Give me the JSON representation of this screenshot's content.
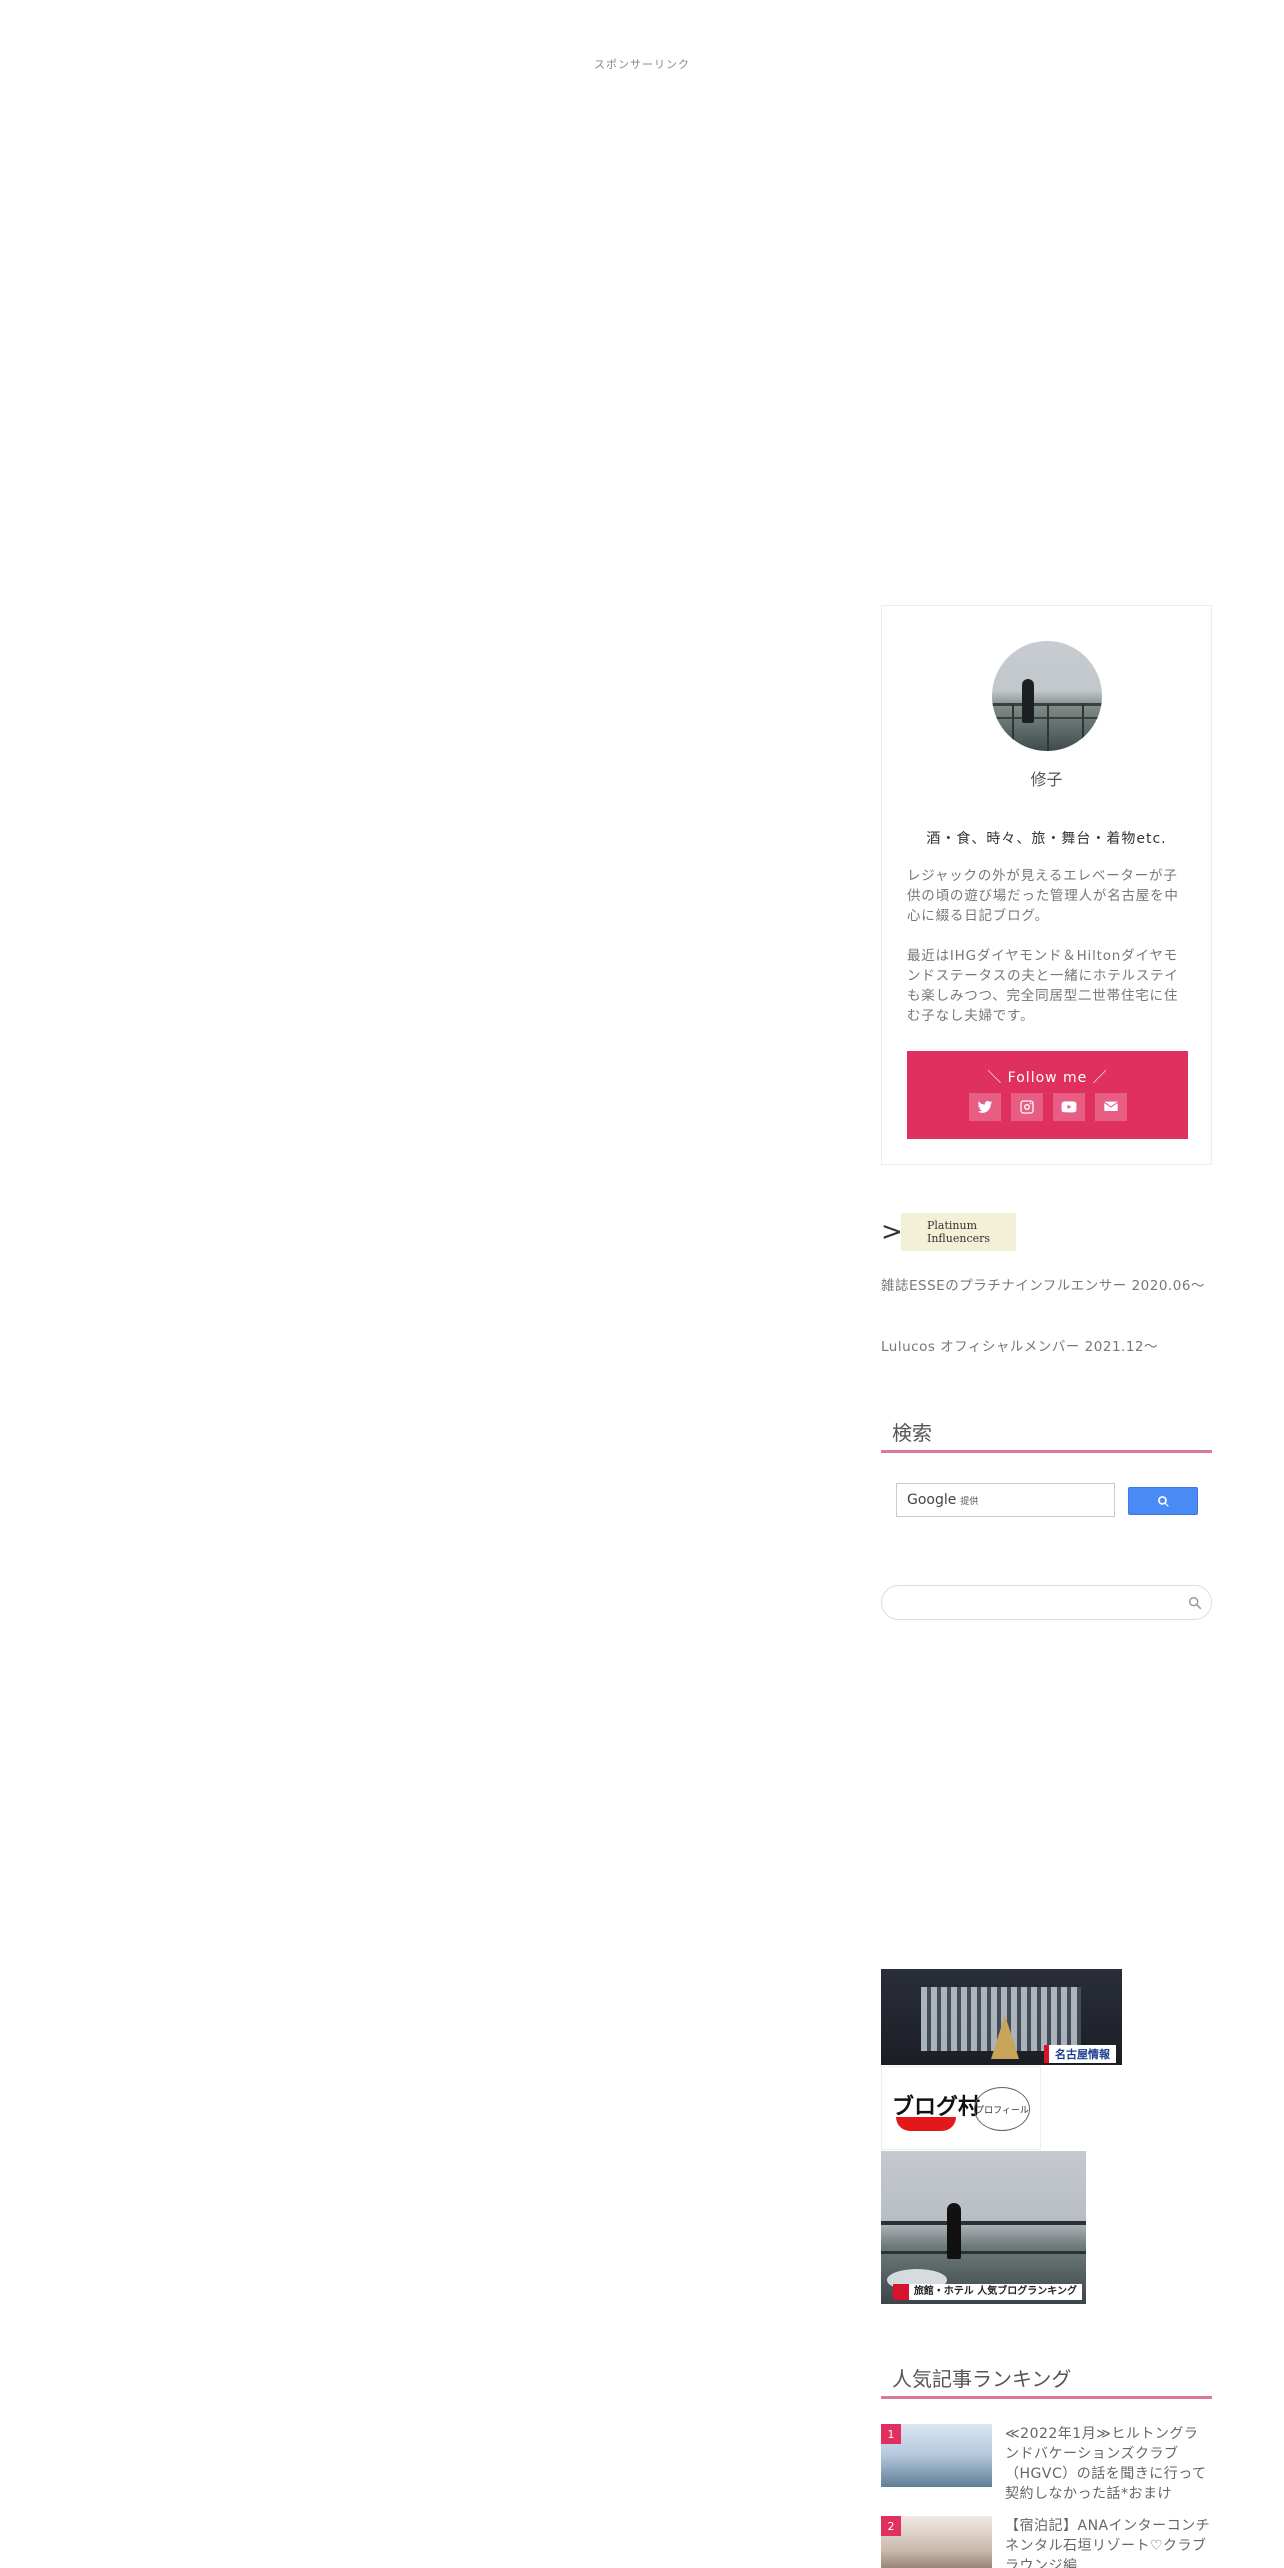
{
  "sponsor_label": "スポンサーリンク",
  "profile": {
    "name": "修子",
    "tagline": "酒・食、時々、旅・舞台・着物etc.",
    "desc1": "レジャックの外が見えるエレベーターが子供の頃の遊び場だった管理人が名古屋を中心に綴る日記ブログ。",
    "desc2": "最近はIHGダイヤモンド＆Hiltonダイヤモンドステータスの夫と一緒にホテルステイも楽しみつつ、完全同居型二世帯住宅に住む子なし夫婦です。",
    "follow_title": "＼ Follow me ／",
    "social_icons": [
      "twitter-icon",
      "instagram-icon",
      "youtube-icon",
      "mail-icon"
    ]
  },
  "platinum": {
    "badge_line1": "Platinum",
    "badge_line2": "Influencers",
    "link1": "雑誌ESSEのプラチナインフルエンサー 2020.06～",
    "link2": "Lulucos オフィシャルメンバー 2021.12～"
  },
  "search_widget": {
    "title": "検索",
    "google_label": "Google",
    "google_sub": "提供"
  },
  "banners": {
    "nagoya_label": "名古屋情報",
    "blogmura_logo": "ブログ村",
    "blogmura_profile": "プロフィール",
    "hotel_label": "旅館・ホテル 人気ブログランキング"
  },
  "ranking": {
    "title": "人気記事ランキング",
    "items": [
      {
        "rank": "1",
        "title": "≪2022年1月≫ヒルトングランドバケーションズクラブ（HGVC）の話を聞きに行って契約しなかった話*おまけ"
      },
      {
        "rank": "2",
        "title": "【宿泊記】ANAインターコンチネンタル石垣リゾート♡クラブラウンジ編"
      }
    ]
  },
  "colors": {
    "accent": "#e03060",
    "title_underline": "#d97a92",
    "google_button": "#4a8af4"
  }
}
